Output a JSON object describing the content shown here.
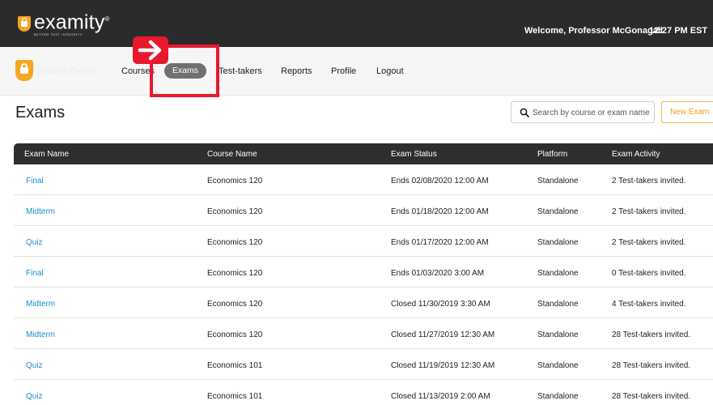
{
  "header": {
    "logo_word": "examity",
    "logo_mark": "®",
    "logo_tagline": "BETTER TEST INTEGRITY",
    "welcome": "Welcome, Professor McGonagall",
    "time": "12:27 PM  EST"
  },
  "nav": {
    "org_name": "Examity Demo",
    "items": [
      {
        "label": "Courses"
      },
      {
        "label": "Exams",
        "active": true
      },
      {
        "label": "Test-takers"
      },
      {
        "label": "Reports"
      },
      {
        "label": "Profile"
      },
      {
        "label": "Logout"
      }
    ]
  },
  "page": {
    "title": "Exams",
    "search_placeholder": "Search by course or exam name",
    "new_exam_label": "New Exam"
  },
  "table": {
    "columns": [
      "Exam Name",
      "Course Name",
      "Exam Status",
      "Platform",
      "Exam Activity"
    ],
    "rows": [
      {
        "exam": "Final",
        "course": "Economics 120",
        "status": "Ends 02/08/2020 12:00 AM",
        "platform": "Standalone",
        "activity": "2 Test-takers invited."
      },
      {
        "exam": "Midterm",
        "course": "Economics 120",
        "status": "Ends 01/18/2020 12:00 AM",
        "platform": "Standalone",
        "activity": "2 Test-takers invited."
      },
      {
        "exam": "Quiz",
        "course": "Economics 120",
        "status": "Ends 01/17/2020 12:00 AM",
        "platform": "Standalone",
        "activity": "2 Test-takers invited."
      },
      {
        "exam": "Final",
        "course": "Economics 120",
        "status": "Ends 01/03/2020 3:00 AM",
        "platform": "Standalone",
        "activity": "0 Test-takers invited."
      },
      {
        "exam": "Midterm",
        "course": "Economics 120",
        "status": "Closed 11/30/2019 3:30 AM",
        "platform": "Standalone",
        "activity": "4 Test-takers invited."
      },
      {
        "exam": "Midterm",
        "course": "Economics 120",
        "status": "Closed 11/27/2019 12:30 AM",
        "platform": "Standalone",
        "activity": "28 Test-takers invited."
      },
      {
        "exam": "Quiz",
        "course": "Economics 101",
        "status": "Closed 11/19/2019 12:30 AM",
        "platform": "Standalone",
        "activity": "28 Test-takers invited."
      },
      {
        "exam": "Quiz",
        "course": "Economics 101",
        "status": "Closed 11/13/2019 2:00 AM",
        "platform": "Standalone",
        "activity": "28 Test-takers invited."
      }
    ]
  },
  "colors": {
    "header_bg": "#2b2b2b",
    "brand_orange": "#f5a623",
    "link_blue": "#1a8fcf",
    "annotation_red": "#e8192c",
    "active_pill": "#707070"
  },
  "icons": {
    "logo": "lock-shield-icon",
    "search": "search-icon",
    "annotation": "arrow-right-icon"
  }
}
